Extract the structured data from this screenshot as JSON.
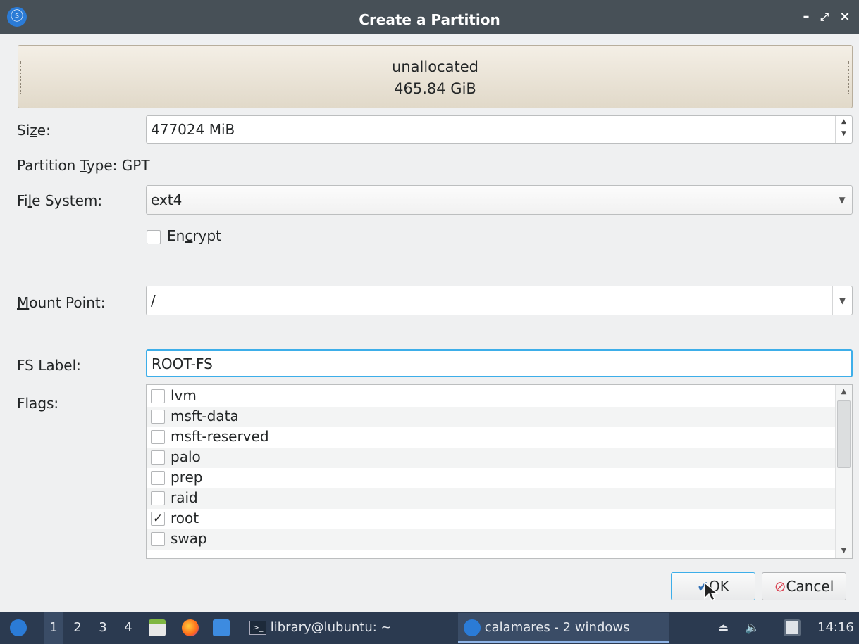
{
  "window": {
    "title": "Create a Partition",
    "controls": {
      "minimize": "–",
      "restore": "⤢",
      "close": "×"
    }
  },
  "partition_bar": {
    "name": "unallocated",
    "size": "465.84 GiB"
  },
  "form": {
    "size": {
      "label_pre": "Si",
      "label_u": "z",
      "label_post": "e:",
      "value": "477024 MiB"
    },
    "partition_type": {
      "label_pre": "Partition ",
      "label_u": "T",
      "label_post": "ype:",
      "value": "GPT"
    },
    "file_system": {
      "label_pre": "Fi",
      "label_u": "l",
      "label_post": "e System:",
      "value": "ext4"
    },
    "encrypt": {
      "label_pre": "En",
      "label_u": "c",
      "label_post": "rypt",
      "checked": false
    },
    "mount_point": {
      "label_pre": "",
      "label_u": "M",
      "label_post": "ount Point:",
      "value": "/"
    },
    "fs_label": {
      "label": "FS Label:",
      "value": "ROOT-FS"
    },
    "flags": {
      "label": "Flags:",
      "items": [
        {
          "label": "lvm",
          "checked": false
        },
        {
          "label": "msft-data",
          "checked": false
        },
        {
          "label": "msft-reserved",
          "checked": false
        },
        {
          "label": "palo",
          "checked": false
        },
        {
          "label": "prep",
          "checked": false
        },
        {
          "label": "raid",
          "checked": false
        },
        {
          "label": "root",
          "checked": true
        },
        {
          "label": "swap",
          "checked": false
        }
      ]
    }
  },
  "buttons": {
    "ok": "OK",
    "cancel": "Cancel"
  },
  "taskbar": {
    "workspaces": [
      "1",
      "2",
      "3",
      "4"
    ],
    "terminal_task": "library@lubuntu: ~",
    "calamares_task": "calamares - 2 windows",
    "clock": "14:16"
  },
  "colors": {
    "titlebar": "#475057",
    "taskbar": "#2b3a50",
    "accent": "#3daee9",
    "partition_fill": "#e9e2d4"
  }
}
